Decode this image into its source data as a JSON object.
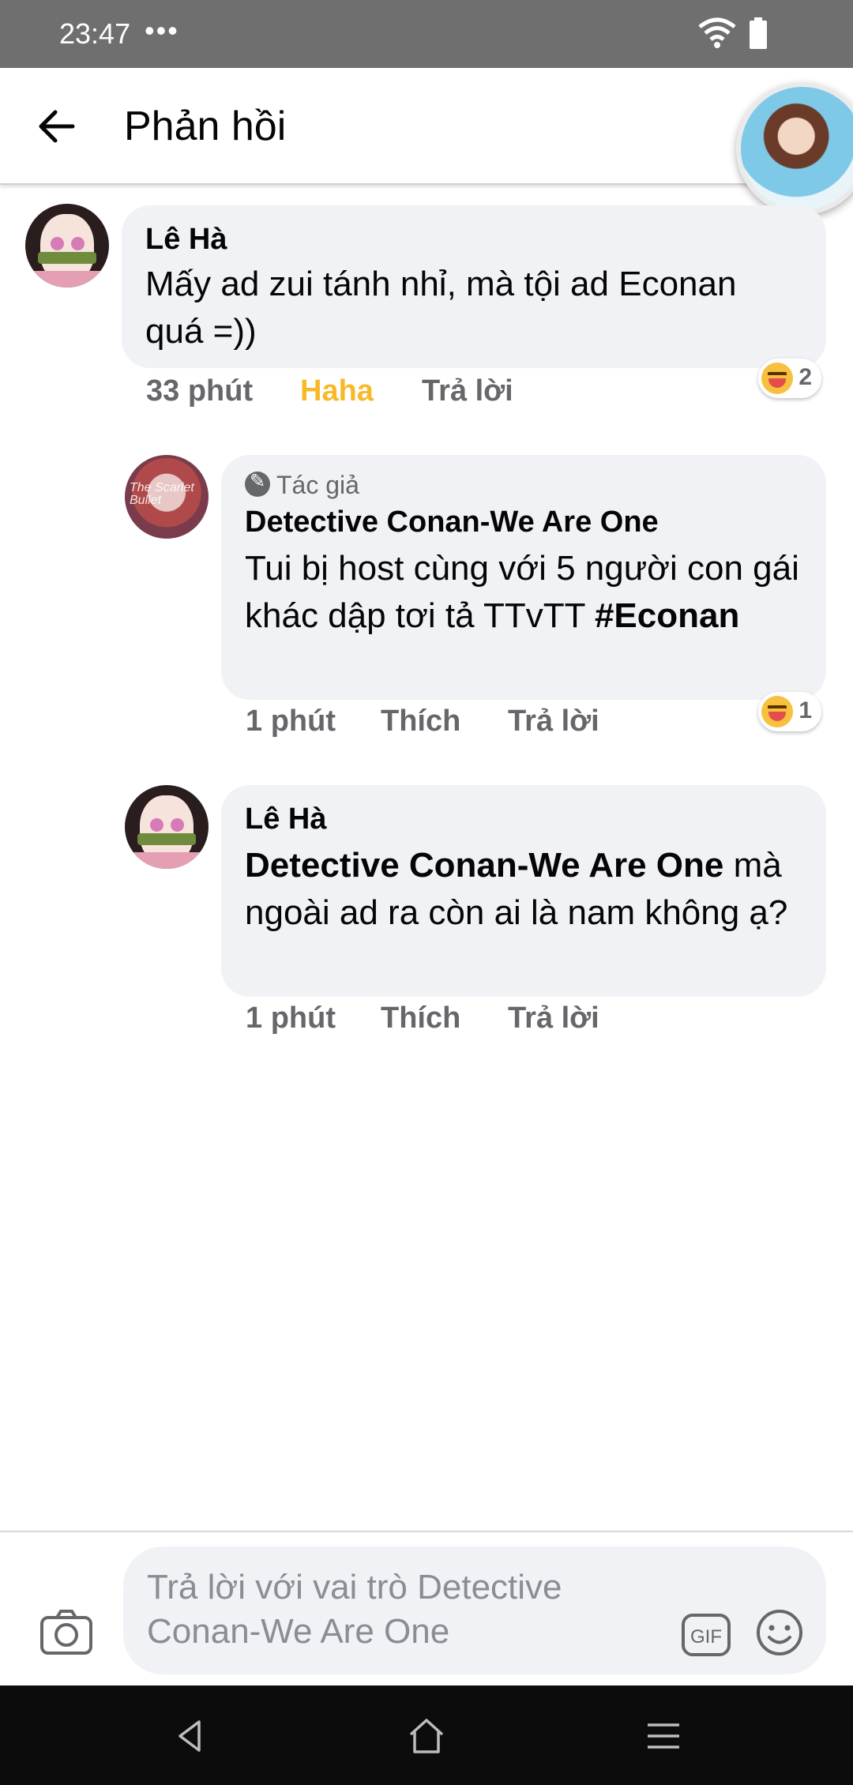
{
  "status_bar": {
    "time": "23:47",
    "dots": "•••"
  },
  "header": {
    "title": "Phản hồi"
  },
  "comments": [
    {
      "author": "Lê Hà",
      "text": "Mấy ad zui tánh nhỉ, mà tội ad Econan quá =))",
      "time": "33 phút",
      "like_label": "Haha",
      "reply_label": "Trả lời",
      "reaction_count": "2"
    },
    {
      "badge": "Tác giả",
      "author": "Detective Conan-We Are One",
      "text": "Tui bị host cùng với 5 người con gái khác dập tơi tả TTvTT",
      "hashtag": "#Econan",
      "time": "1 phút",
      "like_label": "Thích",
      "reply_label": "Trả lời",
      "reaction_count": "1"
    },
    {
      "author": "Lê Hà",
      "mention": "Detective Conan-We Are One",
      "text": " mà ngoài ad ra còn ai là nam không ạ?",
      "time": "1 phút",
      "like_label": "Thích",
      "reply_label": "Trả lời"
    }
  ],
  "composer": {
    "placeholder": "Trả lời với vai trò Detective Conan-We Are One",
    "gif_label": "GIF"
  },
  "icons": {
    "back": "arrow-left-icon",
    "camera": "camera-icon",
    "gif": "gif-icon",
    "emoji": "smiley-icon",
    "reaction": "haha-emoji-icon"
  },
  "colors": {
    "haha_active": "#f7b928",
    "bubble": "#f0f2f5",
    "meta": "#65676b"
  }
}
